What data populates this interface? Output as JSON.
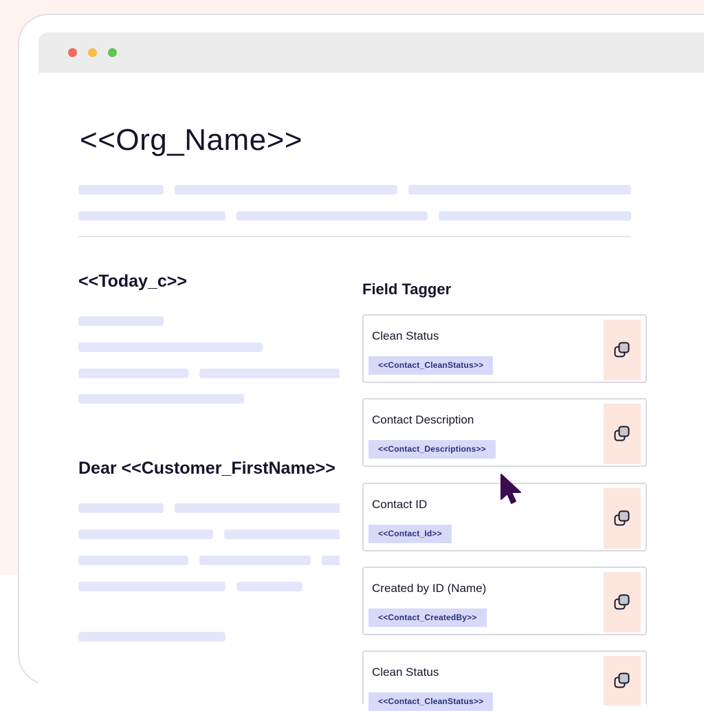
{
  "document": {
    "title": "<<Org_Name>>",
    "date_tag": "<<Today_c>>",
    "greeting": "Dear <<Customer_FirstName>>"
  },
  "field_tagger": {
    "title": "Field Tagger",
    "fields": [
      {
        "label": "Clean Status",
        "tag": "<<Contact_CleanStatus>>"
      },
      {
        "label": "Contact Description",
        "tag": "<<Contact_Descriptions>>"
      },
      {
        "label": "Contact ID",
        "tag": "<<Contact_Id>>"
      },
      {
        "label": "Created by ID (Name)",
        "tag": "<<Contact_CreatedBy>>"
      },
      {
        "label": "Clean Status",
        "tag": "<<Contact_CleanStatus>>"
      }
    ]
  },
  "icons": {
    "copy": "copy-icon",
    "cursor": "mouse-pointer-icon"
  },
  "colors": {
    "background_blush": "#fff3f0",
    "placeholder_bar": "#e3e6fb",
    "tag_chip": "#d6daf8",
    "copy_button": "#fde6de",
    "cursor": "#3b0a4f"
  }
}
